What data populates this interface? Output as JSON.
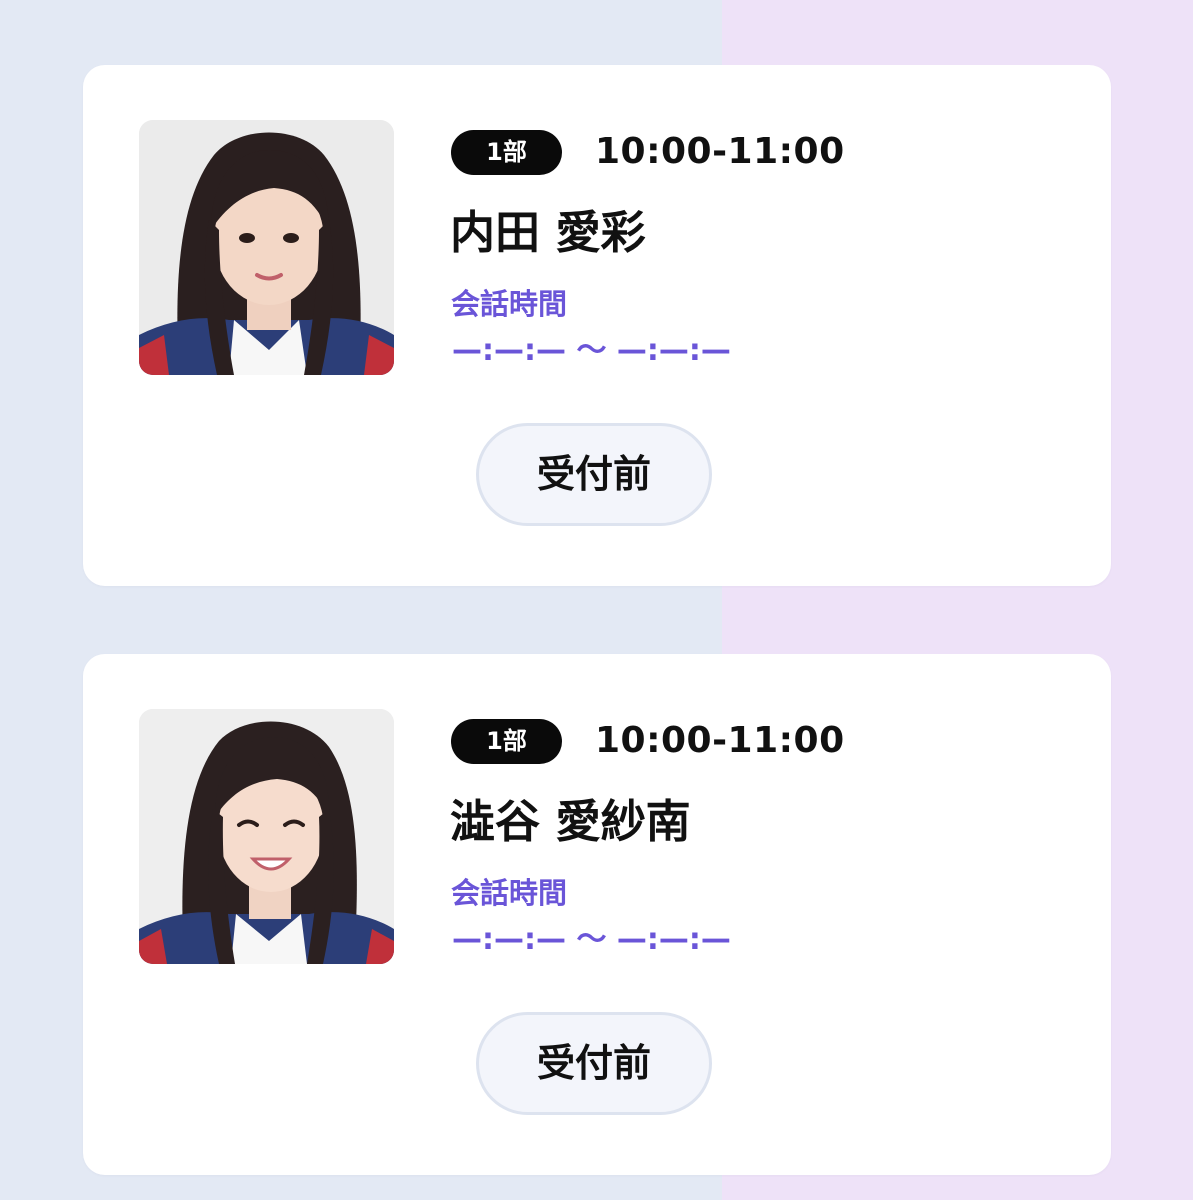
{
  "cards": [
    {
      "part": "1部",
      "time_range": "10:00-11:00",
      "name": "内田 愛彩",
      "talk_label": "会話時間",
      "talk_time": "—:—:— 〜 —:—:—",
      "status": "受付前"
    },
    {
      "part": "1部",
      "time_range": "10:00-11:00",
      "name": "澁谷 愛紗南",
      "talk_label": "会話時間",
      "talk_time": "—:—:— 〜 —:—:—",
      "status": "受付前"
    }
  ],
  "colors": {
    "accent": "#6a55d8",
    "badge_bg": "#0a0a0a",
    "button_bg": "#f3f5fb",
    "bg_left": "#e3e9f4",
    "bg_right": "#eee2f8"
  }
}
